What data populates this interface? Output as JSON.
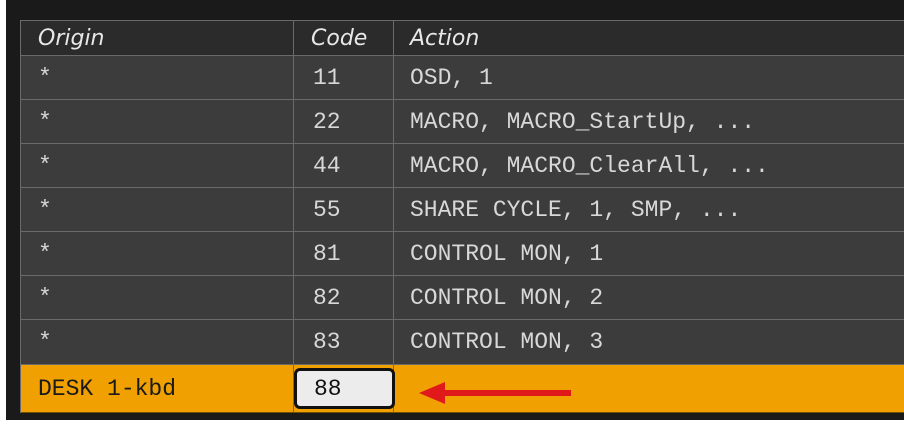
{
  "table": {
    "headers": {
      "origin": "Origin",
      "code": "Code",
      "action": "Action"
    },
    "rows": [
      {
        "origin": "*",
        "code": "11",
        "action": "OSD, 1"
      },
      {
        "origin": "*",
        "code": "22",
        "action": "MACRO, MACRO_StartUp, ..."
      },
      {
        "origin": "*",
        "code": "44",
        "action": "MACRO, MACRO_ClearAll, ..."
      },
      {
        "origin": "*",
        "code": "55",
        "action": "SHARE CYCLE, 1, SMP, ..."
      },
      {
        "origin": "*",
        "code": "81",
        "action": "CONTROL MON, 1"
      },
      {
        "origin": "*",
        "code": "82",
        "action": "CONTROL MON, 2"
      },
      {
        "origin": "*",
        "code": "83",
        "action": "CONTROL MON, 3"
      }
    ],
    "selected_row": {
      "origin": "DESK 1-kbd",
      "code": "88",
      "action": ""
    }
  },
  "colors": {
    "selected_row": "#f0a000",
    "row_bg": "#3c3c3c",
    "annotation_arrow": "#e0191b"
  },
  "annotation": {
    "icon": "red-arrow-left-icon"
  }
}
